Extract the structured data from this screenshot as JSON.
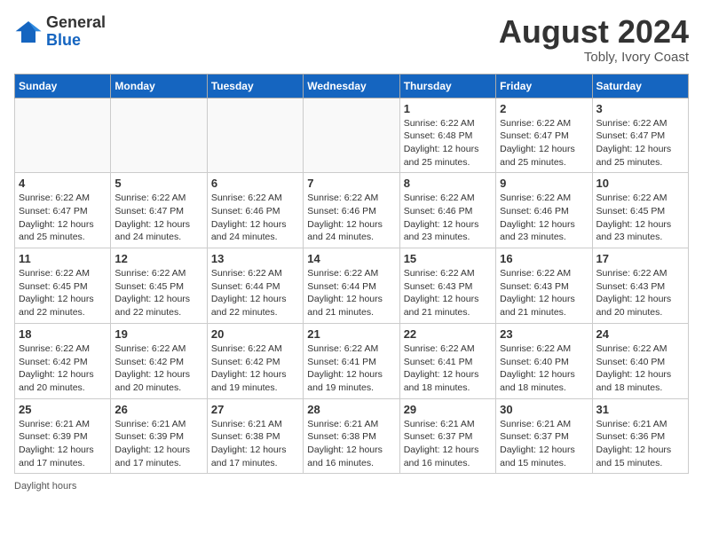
{
  "header": {
    "logo_general": "General",
    "logo_blue": "Blue",
    "month_year": "August 2024",
    "location": "Tobly, Ivory Coast"
  },
  "days_of_week": [
    "Sunday",
    "Monday",
    "Tuesday",
    "Wednesday",
    "Thursday",
    "Friday",
    "Saturday"
  ],
  "footer": {
    "daylight_hours": "Daylight hours"
  },
  "weeks": [
    [
      {
        "day": "",
        "info": ""
      },
      {
        "day": "",
        "info": ""
      },
      {
        "day": "",
        "info": ""
      },
      {
        "day": "",
        "info": ""
      },
      {
        "day": "1",
        "info": "Sunrise: 6:22 AM\nSunset: 6:48 PM\nDaylight: 12 hours\nand 25 minutes."
      },
      {
        "day": "2",
        "info": "Sunrise: 6:22 AM\nSunset: 6:47 PM\nDaylight: 12 hours\nand 25 minutes."
      },
      {
        "day": "3",
        "info": "Sunrise: 6:22 AM\nSunset: 6:47 PM\nDaylight: 12 hours\nand 25 minutes."
      }
    ],
    [
      {
        "day": "4",
        "info": "Sunrise: 6:22 AM\nSunset: 6:47 PM\nDaylight: 12 hours\nand 25 minutes."
      },
      {
        "day": "5",
        "info": "Sunrise: 6:22 AM\nSunset: 6:47 PM\nDaylight: 12 hours\nand 24 minutes."
      },
      {
        "day": "6",
        "info": "Sunrise: 6:22 AM\nSunset: 6:46 PM\nDaylight: 12 hours\nand 24 minutes."
      },
      {
        "day": "7",
        "info": "Sunrise: 6:22 AM\nSunset: 6:46 PM\nDaylight: 12 hours\nand 24 minutes."
      },
      {
        "day": "8",
        "info": "Sunrise: 6:22 AM\nSunset: 6:46 PM\nDaylight: 12 hours\nand 23 minutes."
      },
      {
        "day": "9",
        "info": "Sunrise: 6:22 AM\nSunset: 6:46 PM\nDaylight: 12 hours\nand 23 minutes."
      },
      {
        "day": "10",
        "info": "Sunrise: 6:22 AM\nSunset: 6:45 PM\nDaylight: 12 hours\nand 23 minutes."
      }
    ],
    [
      {
        "day": "11",
        "info": "Sunrise: 6:22 AM\nSunset: 6:45 PM\nDaylight: 12 hours\nand 22 minutes."
      },
      {
        "day": "12",
        "info": "Sunrise: 6:22 AM\nSunset: 6:45 PM\nDaylight: 12 hours\nand 22 minutes."
      },
      {
        "day": "13",
        "info": "Sunrise: 6:22 AM\nSunset: 6:44 PM\nDaylight: 12 hours\nand 22 minutes."
      },
      {
        "day": "14",
        "info": "Sunrise: 6:22 AM\nSunset: 6:44 PM\nDaylight: 12 hours\nand 21 minutes."
      },
      {
        "day": "15",
        "info": "Sunrise: 6:22 AM\nSunset: 6:43 PM\nDaylight: 12 hours\nand 21 minutes."
      },
      {
        "day": "16",
        "info": "Sunrise: 6:22 AM\nSunset: 6:43 PM\nDaylight: 12 hours\nand 21 minutes."
      },
      {
        "day": "17",
        "info": "Sunrise: 6:22 AM\nSunset: 6:43 PM\nDaylight: 12 hours\nand 20 minutes."
      }
    ],
    [
      {
        "day": "18",
        "info": "Sunrise: 6:22 AM\nSunset: 6:42 PM\nDaylight: 12 hours\nand 20 minutes."
      },
      {
        "day": "19",
        "info": "Sunrise: 6:22 AM\nSunset: 6:42 PM\nDaylight: 12 hours\nand 20 minutes."
      },
      {
        "day": "20",
        "info": "Sunrise: 6:22 AM\nSunset: 6:42 PM\nDaylight: 12 hours\nand 19 minutes."
      },
      {
        "day": "21",
        "info": "Sunrise: 6:22 AM\nSunset: 6:41 PM\nDaylight: 12 hours\nand 19 minutes."
      },
      {
        "day": "22",
        "info": "Sunrise: 6:22 AM\nSunset: 6:41 PM\nDaylight: 12 hours\nand 18 minutes."
      },
      {
        "day": "23",
        "info": "Sunrise: 6:22 AM\nSunset: 6:40 PM\nDaylight: 12 hours\nand 18 minutes."
      },
      {
        "day": "24",
        "info": "Sunrise: 6:22 AM\nSunset: 6:40 PM\nDaylight: 12 hours\nand 18 minutes."
      }
    ],
    [
      {
        "day": "25",
        "info": "Sunrise: 6:21 AM\nSunset: 6:39 PM\nDaylight: 12 hours\nand 17 minutes."
      },
      {
        "day": "26",
        "info": "Sunrise: 6:21 AM\nSunset: 6:39 PM\nDaylight: 12 hours\nand 17 minutes."
      },
      {
        "day": "27",
        "info": "Sunrise: 6:21 AM\nSunset: 6:38 PM\nDaylight: 12 hours\nand 17 minutes."
      },
      {
        "day": "28",
        "info": "Sunrise: 6:21 AM\nSunset: 6:38 PM\nDaylight: 12 hours\nand 16 minutes."
      },
      {
        "day": "29",
        "info": "Sunrise: 6:21 AM\nSunset: 6:37 PM\nDaylight: 12 hours\nand 16 minutes."
      },
      {
        "day": "30",
        "info": "Sunrise: 6:21 AM\nSunset: 6:37 PM\nDaylight: 12 hours\nand 15 minutes."
      },
      {
        "day": "31",
        "info": "Sunrise: 6:21 AM\nSunset: 6:36 PM\nDaylight: 12 hours\nand 15 minutes."
      }
    ]
  ]
}
